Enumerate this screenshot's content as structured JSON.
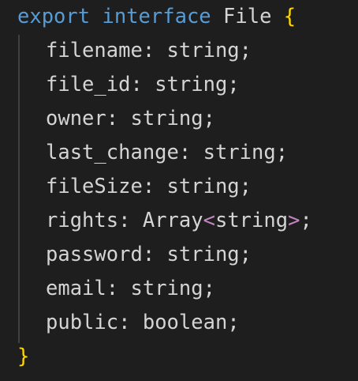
{
  "code": {
    "line1": {
      "keyword_export": "export",
      "keyword_interface": "interface",
      "name": "File",
      "open_brace": "{"
    },
    "fields": [
      {
        "name": "filename",
        "type": "string"
      },
      {
        "name": "file_id",
        "type": "string"
      },
      {
        "name": "owner",
        "type": "string"
      },
      {
        "name": "last_change",
        "type": "string"
      },
      {
        "name": "fileSize",
        "type": "string"
      },
      {
        "name": "rights",
        "type_prefix": "Array",
        "open_angle": "<",
        "type_arg": "string",
        "close_angle": ">"
      },
      {
        "name": "password",
        "type": "string"
      },
      {
        "name": "email",
        "type": "string"
      },
      {
        "name": "public",
        "type": "boolean"
      }
    ],
    "close_brace": "}",
    "colon": ":",
    "semicolon": ";"
  },
  "colors": {
    "background": "#1e1e1e",
    "keyword": "#569cd6",
    "text": "#d4d4d4",
    "brace": "#ffd700",
    "angle_bracket": "#c586c0",
    "indent_guide": "#404040"
  }
}
